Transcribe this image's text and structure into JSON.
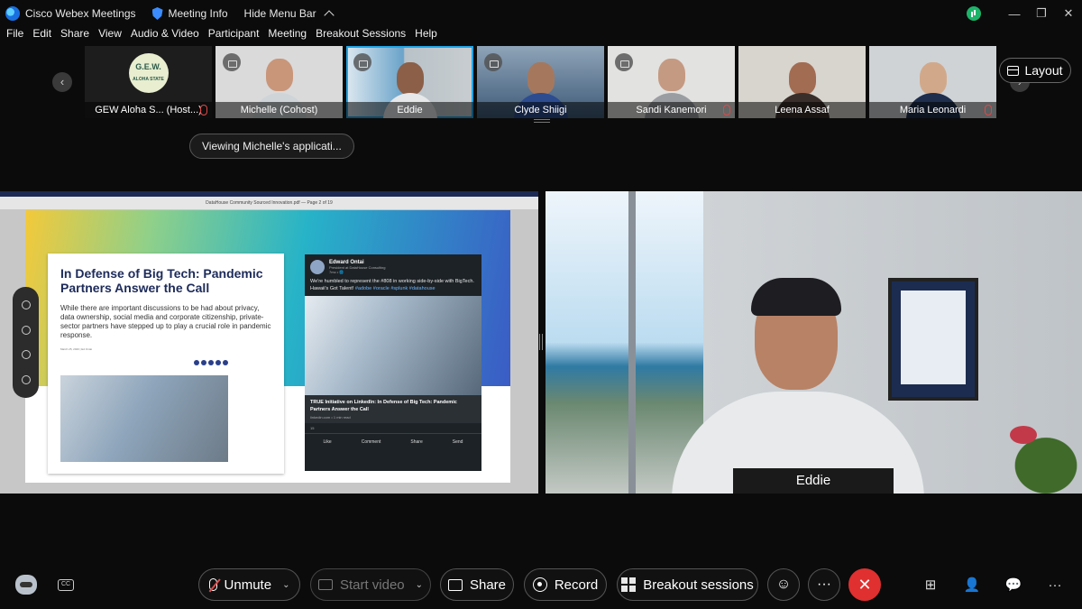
{
  "titlebar": {
    "app_name": "Cisco Webex Meetings",
    "meeting_info": "Meeting Info",
    "hide_menu": "Hide Menu Bar",
    "min": "—",
    "restore": "❐",
    "close": "✕"
  },
  "menubar": [
    "File",
    "Edit",
    "Share",
    "View",
    "Audio & Video",
    "Participant",
    "Meeting",
    "Breakout Sessions",
    "Help"
  ],
  "participants": [
    {
      "name": "GEW Aloha S... (Host...)",
      "muted": true,
      "logo_text": "G.E.W.\nALOHA STATE"
    },
    {
      "name": "Michelle  (Cohost)",
      "muted": false
    },
    {
      "name": "Eddie",
      "muted": false,
      "active": true
    },
    {
      "name": "Clyde Shiigi",
      "muted": false
    },
    {
      "name": "Sandi Kanemori",
      "muted": true
    },
    {
      "name": "Leena Assaf",
      "muted": false
    },
    {
      "name": "Maria Leonardi",
      "muted": true
    }
  ],
  "filmstrip_nav": {
    "left": "‹",
    "right": "›"
  },
  "layout_button": "Layout",
  "viewing_label": "Viewing Michelle's applicati...",
  "shared_doc": {
    "window_title": "DataHouse Community Sourced Innovation.pdf — Page 2 of 19",
    "slide_heading": "In Defense of Big Tech: Pandemic Partners Answer the Call",
    "slide_body": "While there are important discussions to be had about privacy, data ownership, social media and corporate citizenship, private-sector partners have stepped up to play a crucial role in pandemic response.",
    "slide_meta": "March 25, 2020 | Ed Ontai",
    "linkedin": {
      "author": "Edward Ontai",
      "author_title": "President at DataHouse Consulting",
      "time": "7mo • 🌐",
      "text": "We're humbled to represent the #808 in working side-by-side with BigTech. Hawaii's Got Talent! ",
      "tags": "#adobe #oracle #splunk #datahouse",
      "caption": "TRUE Initiative on LinkedIn: In Defense of Big Tech: Pandemic Partners Answer the Call",
      "link": "linkedin.com • 1 min read",
      "reactions": "15",
      "actions": [
        "Like",
        "Comment",
        "Share",
        "Send"
      ]
    }
  },
  "video": {
    "speaker": "Eddie"
  },
  "controls": {
    "unmute": "Unmute",
    "start_video": "Start video",
    "share": "Share",
    "record": "Record",
    "breakout": "Breakout sessions",
    "more": "···",
    "end": "✕"
  },
  "colors": {
    "accent": "#1fa6e8",
    "end_call": "#e0302f",
    "muted_mic": "#e04848"
  }
}
